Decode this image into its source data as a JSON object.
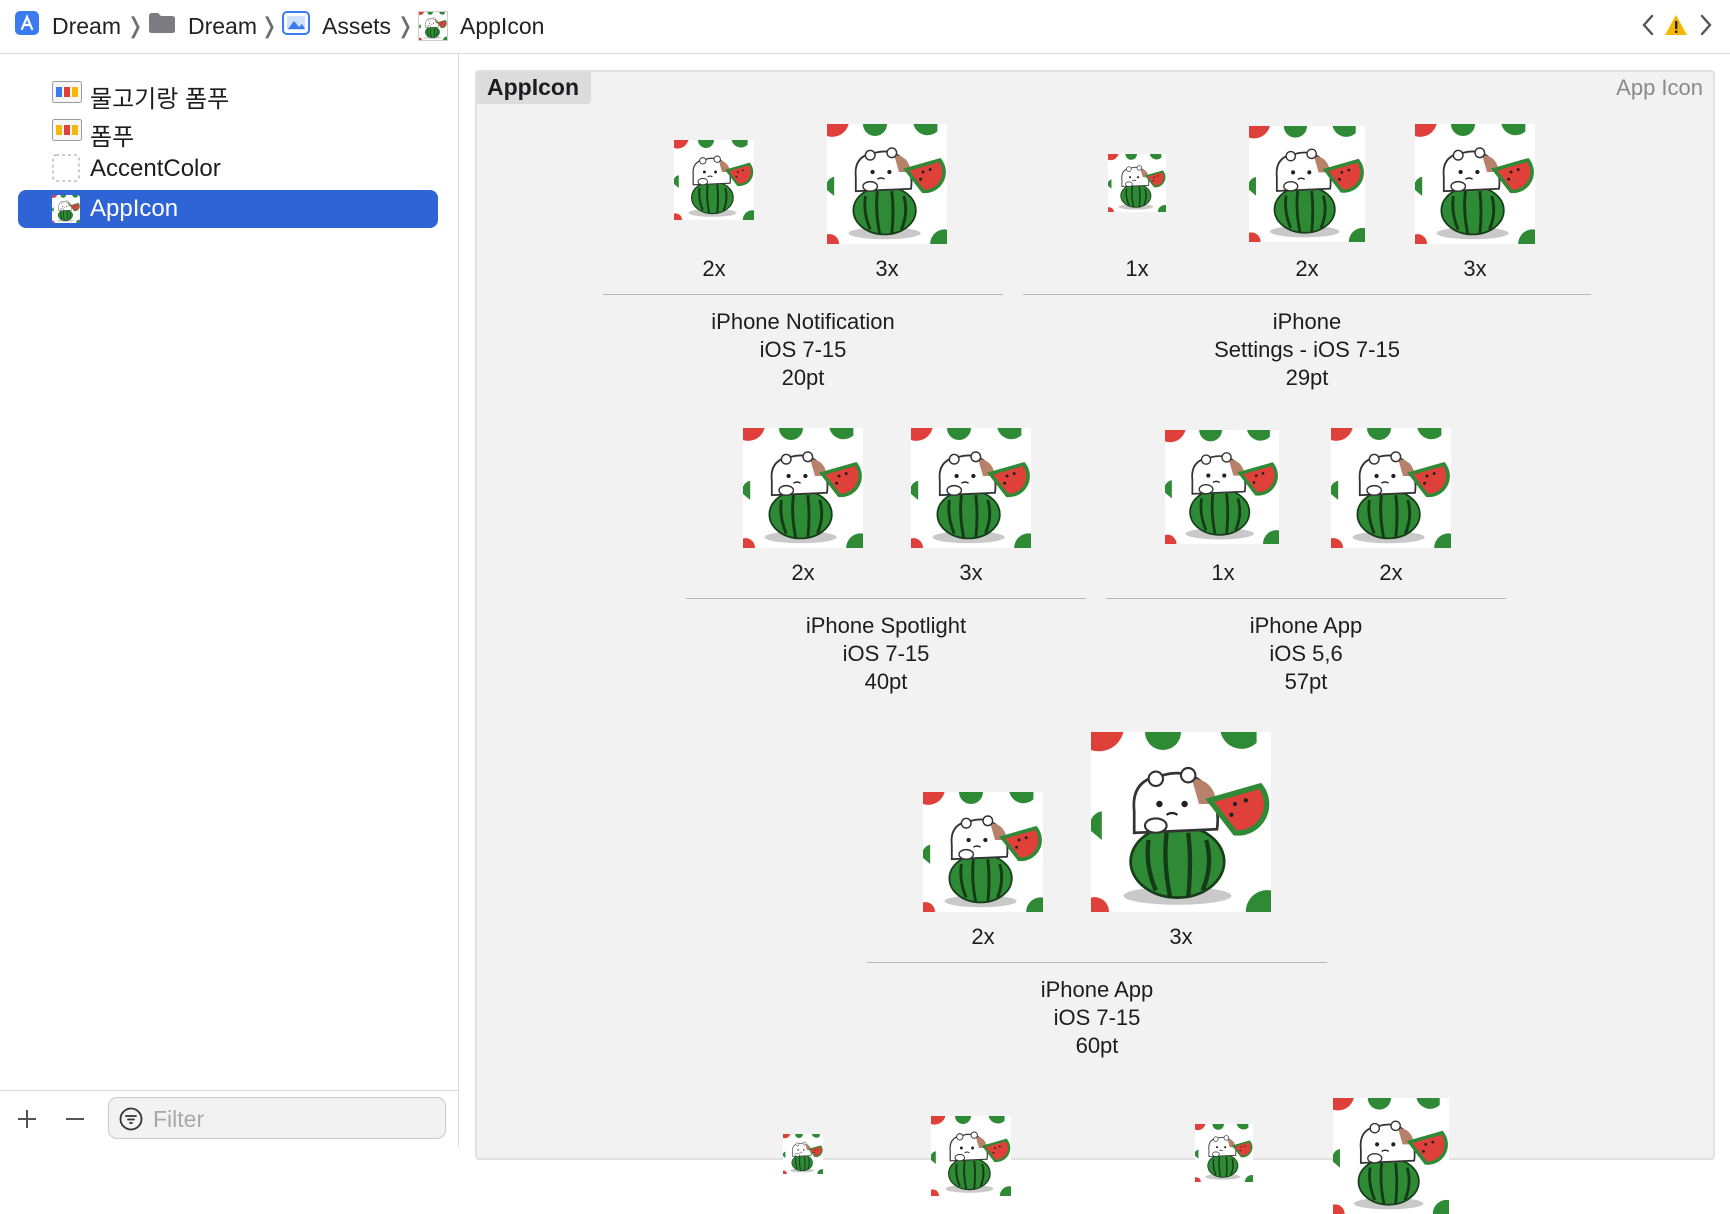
{
  "breadcrumb": {
    "items": [
      {
        "label": "Dream",
        "icon": "xcode-project-icon"
      },
      {
        "label": "Dream",
        "icon": "folder-icon"
      },
      {
        "label": "Assets",
        "icon": "asset-catalog-icon"
      },
      {
        "label": "AppIcon",
        "icon": "appicon-thumbnail-icon"
      }
    ]
  },
  "navigator": {
    "assets": [
      {
        "label": "물고기랑 폼푸",
        "icon": "image-set-icon"
      },
      {
        "label": "폼푸",
        "icon": "image-set-icon"
      },
      {
        "label": "AccentColor",
        "icon": "color-set-icon"
      },
      {
        "label": "AppIcon",
        "icon": "app-icon-set-icon",
        "selected": true
      }
    ],
    "filter_placeholder": "Filter"
  },
  "editor": {
    "set_name": "AppIcon",
    "set_kind": "App Icon",
    "groups": [
      {
        "line1": "iPhone Notification",
        "line2": "iOS 7-15",
        "line3": "20pt",
        "slots": [
          "2x",
          "3x"
        ]
      },
      {
        "line1": "iPhone",
        "line2": "Settings - iOS 7-15",
        "line3": "29pt",
        "slots": [
          "1x",
          "2x",
          "3x"
        ]
      },
      {
        "line1": "iPhone Spotlight",
        "line2": "iOS 7-15",
        "line3": "40pt",
        "slots": [
          "2x",
          "3x"
        ]
      },
      {
        "line1": "iPhone App",
        "line2": "iOS 5,6",
        "line3": "57pt",
        "slots": [
          "1x",
          "2x"
        ]
      },
      {
        "line1": "iPhone App",
        "line2": "iOS 7-15",
        "line3": "60pt",
        "slots": [
          "2x",
          "3x"
        ]
      }
    ]
  },
  "colors": {
    "selection": "#2e64d6",
    "warning": "#f5b800",
    "watermelon_green": "#2f8a36",
    "watermelon_red": "#e0403a"
  }
}
